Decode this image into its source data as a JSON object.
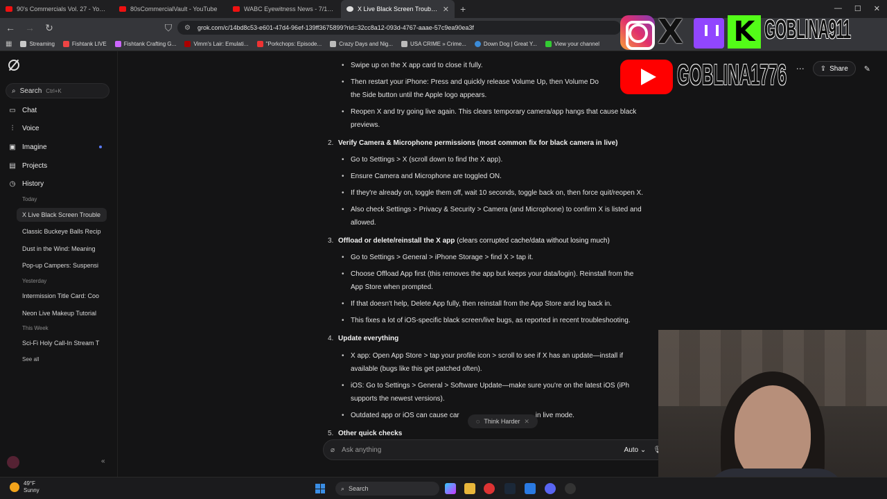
{
  "browser": {
    "tabs": [
      {
        "label": "90's Commercials Vol. 27 - YouTube",
        "active": false
      },
      {
        "label": "80sCommercialVault - YouTube",
        "active": false
      },
      {
        "label": "WABC Eyewitness News - 7/14/77 - Y",
        "active": false
      },
      {
        "label": "X Live Black Screen Troubleshoot",
        "active": true
      }
    ],
    "new_tab": "+",
    "url": "grok.com/c/14bd8c53-e601-47d4-96ef-139ff3675899?rid=32cc8a12-093d-4767-aaae-57c9ea90ea3f",
    "bookmarks": [
      "Streaming",
      "Fishtank LIVE",
      "Fishtank Crafting G...",
      "Vimm's Lair: Emulati...",
      "\"Porkchops: Episode...",
      "Crazy Days and Nig...",
      "USA CRIME » Crime...",
      "Down Dog | Great Y...",
      "View your channel"
    ]
  },
  "sidebar": {
    "search_label": "Search",
    "search_shortcut": "Ctrl+K",
    "nav": [
      {
        "label": "Chat",
        "icon": "chat-icon"
      },
      {
        "label": "Voice",
        "icon": "voice-icon"
      },
      {
        "label": "Imagine",
        "icon": "imagine-icon"
      },
      {
        "label": "Projects",
        "icon": "projects-icon"
      },
      {
        "label": "History",
        "icon": "history-icon"
      }
    ],
    "sections": [
      {
        "title": "Today",
        "items": [
          "X Live Black Screen Trouble",
          "Classic Buckeye Balls Recip",
          "Dust in the Wind: Meaning",
          "Pop-up Campers: Suspensi"
        ]
      },
      {
        "title": "Yesterday",
        "items": [
          "Intermission Title Card: Coo",
          "Neon Live Makeup Tutorial"
        ]
      },
      {
        "title": "This Week",
        "items": [
          "Sci-Fi Holy Call-In Stream T"
        ]
      }
    ],
    "see_all": "See all"
  },
  "header": {
    "share_label": "Share"
  },
  "content": {
    "s1_b1": "Swipe up on the X app card to close it fully.",
    "s1_b2a": "Then restart your iPhone: Press and quickly release Volume Up, then Volume Do",
    "s1_b2b": "the Side button until the Apple logo appears.",
    "s1_b3a": "Reopen X and try going live again. This clears temporary camera/app hangs that cause black",
    "s1_b3b": "previews.",
    "h2_num": "2.",
    "h2": "Verify Camera & Microphone permissions (most common fix for black camera in live)",
    "s2_b1": "Go to Settings > X (scroll down to find the X app).",
    "s2_b2": "Ensure Camera and Microphone are toggled ON.",
    "s2_b3": "If they're already on, toggle them off, wait 10 seconds, toggle back on, then force quit/reopen X.",
    "s2_b4a": "Also check Settings > Privacy & Security > Camera (and Microphone) to confirm X is listed and",
    "s2_b4b": "allowed.",
    "h3_num": "3.",
    "h3_bold": "Offload or delete/reinstall the X app",
    "h3_rest": " (clears corrupted cache/data without losing much)",
    "s3_b1": "Go to Settings > General > iPhone Storage > find X > tap it.",
    "s3_b2a": "Choose Offload App first (this removes the app but keeps your data/login). Reinstall from the",
    "s3_b2b": "App Store when prompted.",
    "s3_b3": "If that doesn't help, Delete App fully, then reinstall from the App Store and log back in.",
    "s3_b4": "This fixes a lot of iOS-specific black screen/live bugs, as reported in recent troubleshooting.",
    "h4_num": "4.",
    "h4": "Update everything",
    "s4_b1a": "X app: Open App Store > tap your profile icon > scroll to see if X has an update—install if",
    "s4_b1b": "available (bugs like this get patched often).",
    "s4_b2a": "iOS: Go to Settings > General > Software Update—make sure you're on the latest iOS (iPh",
    "s4_b2b": "supports the newest versions).",
    "s4_b3": "Outdated app or iOS can cause car",
    "s4_b3_tail": "in live mode.",
    "h5_num": "5.",
    "h5": "Other quick checks"
  },
  "composer": {
    "think_harder": "Think Harder",
    "placeholder": "Ask anything",
    "model": "Auto"
  },
  "taskbar": {
    "temp": "49°F",
    "condition": "Sunny",
    "search_label": "Search"
  },
  "overlay": {
    "handle_top": "GOBLINA911",
    "handle_youtube": "GOBLINA1776",
    "kick_letter": "K"
  }
}
